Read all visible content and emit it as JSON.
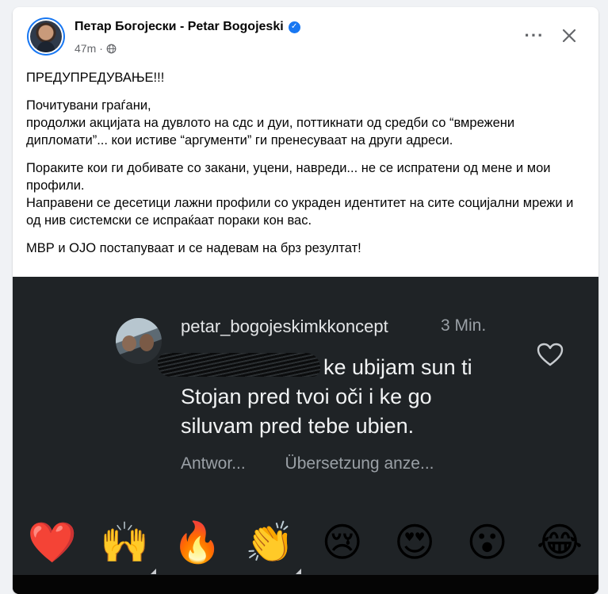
{
  "post": {
    "author": "Петар Богојески - Petar Bogojeski",
    "time": "47m",
    "visibility_icon": "globe-icon",
    "paragraphs": [
      "ПРЕДУПРЕДУВАЊЕ!!!",
      "Почитувани граѓани,\nпродолжи акцијата на дувлото на сдс и дуи, поттикнати од средби со “вмрежени дипломати”... кои истиве “аргументи” ги пренесуваат на други адреси.",
      "Пораките кои ги добивате со закани, уцени, навреди... не се испратени од мене и мои профили.\nНаправени се десетици лажни профили со украден идентитет на сите социјални мрежи и од нив системски се испраќаат пораки кон вас.",
      "МВР и ОЈО постапуваат и се надевам на брз резултат!"
    ]
  },
  "screenshot": {
    "username": "petar_bogojeskimkkoncept",
    "time": "3 Min.",
    "comment_line1": "ke ubijam sun ti",
    "comment_line2": "Stojan pred tvoi oči i ke go",
    "comment_line3": "siluvam pred tebe ubien.",
    "reply": "Antwor...",
    "translate": "Übersetzung anze...",
    "emojis": [
      "❤️",
      "🙌",
      "🔥",
      "👏",
      "😢",
      "😍",
      "😮",
      "😂"
    ]
  },
  "colors": {
    "accent": "#1877f2",
    "text": "#050505",
    "muted": "#65676b",
    "photo_bg": "#1f2326"
  }
}
